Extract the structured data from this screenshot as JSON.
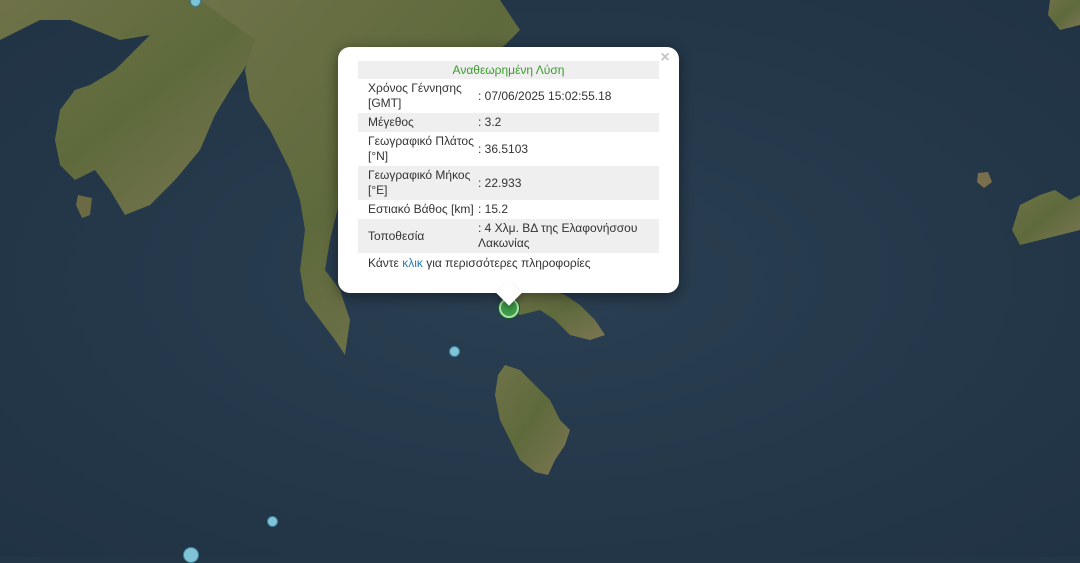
{
  "popup": {
    "title": "Αναθεωρημένη Λύση",
    "close_label": "×",
    "rows": [
      {
        "label": "Χρόνος Γέννησης [GMT]",
        "value": ": 07/06/2025 15:02:55.18"
      },
      {
        "label": "Μέγεθος",
        "value": ": 3.2"
      },
      {
        "label": "Γεωγραφικό Πλάτος [°N]",
        "value": ": 36.5103"
      },
      {
        "label": "Γεωγραφικό Μήκος [°E]",
        "value": ": 22.933"
      },
      {
        "label": "Εστιακό Βάθος [km]",
        "value": ": 15.2"
      },
      {
        "label": "Τοποθεσία",
        "value": ": 4 Χλμ. ΒΔ της Ελαφονήσσου Λακωνίας"
      }
    ],
    "more_prefix": "Κάντε ",
    "more_link": "κλικ",
    "more_suffix": " για περισσότερες πληροφορίες"
  },
  "colors": {
    "sea": "#233647",
    "land": "#6e7048",
    "marker_main": "#3f9c4a",
    "marker_other": "#7fc3d6",
    "title_green": "#3c9a2f",
    "link_blue": "#2a7ab5"
  }
}
